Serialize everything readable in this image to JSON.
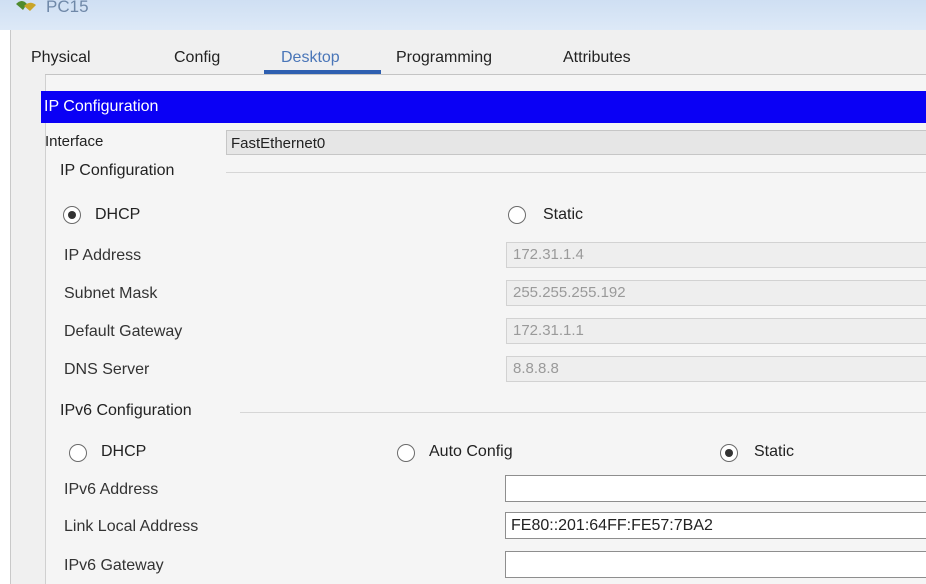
{
  "window": {
    "title": "PC15"
  },
  "tabs": [
    "Physical",
    "Config",
    "Desktop",
    "Programming",
    "Attributes"
  ],
  "active_tab": "Desktop",
  "panel": {
    "header": "IP Configuration",
    "interface_label": "Interface",
    "interface_value": "FastEthernet0"
  },
  "ipv4": {
    "group_title": "IP Configuration",
    "dhcp_label": "DHCP",
    "static_label": "Static",
    "mode": "DHCP",
    "fields": [
      {
        "label": "IP Address",
        "value": "172.31.1.4"
      },
      {
        "label": "Subnet Mask",
        "value": "255.255.255.192"
      },
      {
        "label": "Default Gateway",
        "value": "172.31.1.1"
      },
      {
        "label": "DNS Server",
        "value": "8.8.8.8"
      }
    ]
  },
  "ipv6": {
    "group_title": "IPv6 Configuration",
    "dhcp_label": "DHCP",
    "auto_label": "Auto Config",
    "static_label": "Static",
    "mode": "Static",
    "fields": [
      {
        "label": "IPv6 Address",
        "value": ""
      },
      {
        "label": "Link Local Address",
        "value": "FE80::201:64FF:FE57:7BA2"
      },
      {
        "label": "IPv6 Gateway",
        "value": ""
      }
    ]
  },
  "colors": {
    "header_bg": "#0a00f5",
    "active_tab": "#4a76b8",
    "tab_underline": "#2e5fb0"
  },
  "icons": {
    "app": "pc-icon",
    "radio_selected": "radio-checked",
    "radio_empty": "radio-unchecked"
  }
}
